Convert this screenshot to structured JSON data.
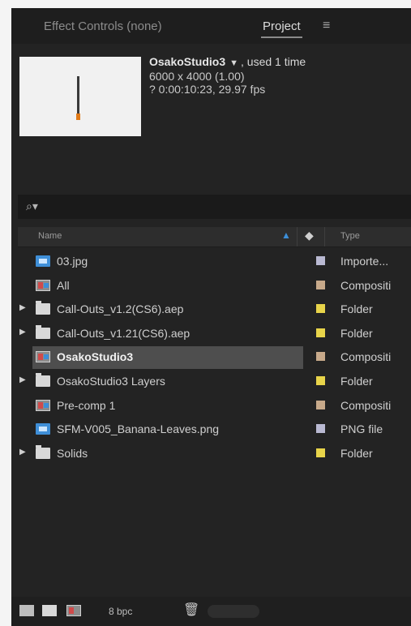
{
  "tabs": {
    "effect_controls": "Effect Controls (none)",
    "project": "Project"
  },
  "info": {
    "comp_name": "OsakoStudio3",
    "dropdown_arrow": "▼",
    "usage": ", used 1 time",
    "dimensions": "6000 x 4000 (1.00)",
    "duration": "? 0:00:10:23, 29.97 fps"
  },
  "search": {
    "icon": "⚲",
    "placeholder": ""
  },
  "header": {
    "name": "Name",
    "type": "Type"
  },
  "items": [
    {
      "name": "03.jpg",
      "icon": "file-icon",
      "expandable": false,
      "type": "Importe...",
      "label_color": "#b9b9d2",
      "selected": false
    },
    {
      "name": "All",
      "icon": "comp-icon",
      "expandable": false,
      "type": "Compositi",
      "label_color": "#c7a98a",
      "selected": false
    },
    {
      "name": "Call-Outs_v1.2(CS6).aep",
      "icon": "folder-icon",
      "expandable": true,
      "type": "Folder",
      "label_color": "#e8d44a",
      "selected": false
    },
    {
      "name": "Call-Outs_v1.21(CS6).aep",
      "icon": "folder-icon",
      "expandable": true,
      "type": "Folder",
      "label_color": "#e8d44a",
      "selected": false
    },
    {
      "name": "OsakoStudio3",
      "icon": "comp-icon",
      "expandable": false,
      "type": "Compositi",
      "label_color": "#c7a98a",
      "selected": true
    },
    {
      "name": "OsakoStudio3 Layers",
      "icon": "folder-icon",
      "expandable": true,
      "type": "Folder",
      "label_color": "#e8d44a",
      "selected": false
    },
    {
      "name": "Pre-comp 1",
      "icon": "comp-icon",
      "expandable": false,
      "type": "Compositi",
      "label_color": "#c7a98a",
      "selected": false
    },
    {
      "name": "SFM-V005_Banana-Leaves.png",
      "icon": "file-icon",
      "expandable": false,
      "type": "PNG file",
      "label_color": "#b9b9d2",
      "selected": false
    },
    {
      "name": "Solids",
      "icon": "folder-icon",
      "expandable": true,
      "type": "Folder",
      "label_color": "#e8d44a",
      "selected": false
    }
  ],
  "footer": {
    "bpc": "8 bpc"
  }
}
